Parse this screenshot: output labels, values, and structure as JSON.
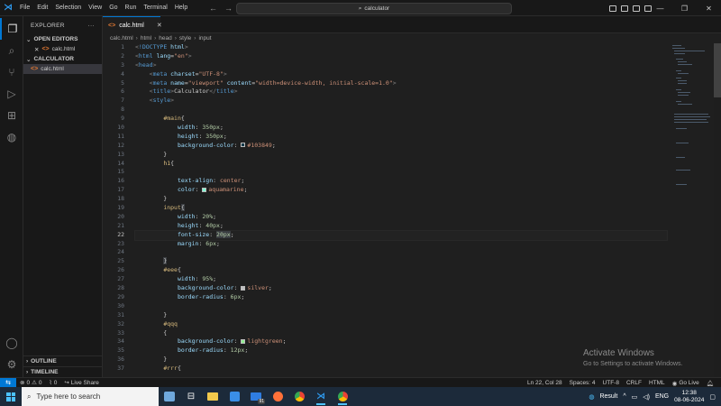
{
  "menu": [
    "File",
    "Edit",
    "Selection",
    "View",
    "Go",
    "Run",
    "Terminal",
    "Help"
  ],
  "search": {
    "text": "calculator"
  },
  "sidebar": {
    "title": "EXPLORER",
    "open_editors": "OPEN EDITORS",
    "open_file": "calc.html",
    "folder": "CALCULATOR",
    "folder_file": "calc.html",
    "outline": "OUTLINE",
    "timeline": "TIMELINE"
  },
  "tab": {
    "label": "calc.html"
  },
  "breadcrumb": [
    "calc.html",
    "html",
    "head",
    "style",
    "input"
  ],
  "editor": {
    "current_line": 22,
    "line_numbers": [
      "1",
      "2",
      "3",
      "4",
      "5",
      "6",
      "7",
      "8",
      "9",
      "10",
      "11",
      "12",
      "13",
      "14",
      "15",
      "16",
      "17",
      "18",
      "19",
      "20",
      "21",
      "22",
      "23",
      "24",
      "25",
      "26",
      "27",
      "28",
      "29",
      "30",
      "31",
      "32",
      "33",
      "34",
      "35",
      "36",
      "37"
    ]
  },
  "colors": {
    "accent": "#0078d4",
    "swatch_main": "#103849",
    "swatch_aquamarine": "#7fffd4",
    "swatch_silver": "#c0c0c0",
    "swatch_lightgreen": "#90ee90"
  },
  "watermark": {
    "title": "Activate Windows",
    "subtitle": "Go to Settings to activate Windows."
  },
  "status": {
    "errors": "0",
    "warnings": "0",
    "ports": "0",
    "live_share": "Live Share",
    "position": "Ln 22, Col 28",
    "spaces": "Spaces: 4",
    "encoding": "UTF-8",
    "eol": "CRLF",
    "language": "HTML",
    "go_live": "Go Live"
  },
  "taskbar": {
    "search_placeholder": "Type here to search",
    "mail_badge": "91",
    "weather": "Result",
    "lang": "ENG",
    "time": "12:38",
    "date": "08-06-2024"
  }
}
